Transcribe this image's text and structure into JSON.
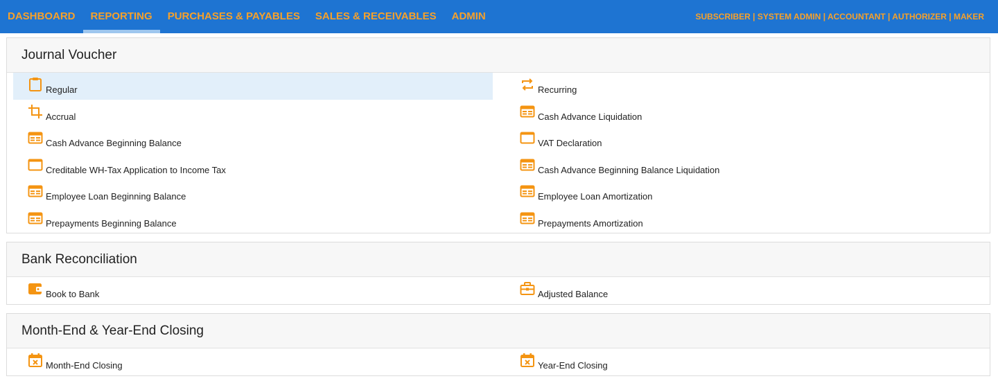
{
  "nav": {
    "items": [
      {
        "label": "DASHBOARD"
      },
      {
        "label": "REPORTING"
      },
      {
        "label": "PURCHASES & PAYABLES"
      },
      {
        "label": "SALES & RECEIVABLES"
      },
      {
        "label": "ADMIN"
      }
    ],
    "active": "REPORTING",
    "user_roles": "SUBSCRIBER | SYSTEM ADMIN | ACCOUNTANT | AUTHORIZER | MAKER"
  },
  "colors": {
    "topbar": "#1e74d2",
    "nav_text": "#f7a12a",
    "active_underline": "#9fc7ef",
    "icon": "#f49412",
    "highlight_row": "#e2effa"
  },
  "sections": [
    {
      "title": "Journal Voucher",
      "items": [
        {
          "label": "Regular",
          "icon": "clipboard-icon",
          "highlighted": true
        },
        {
          "label": "Recurring",
          "icon": "repeat-icon"
        },
        {
          "label": "Accrual",
          "icon": "crop-icon"
        },
        {
          "label": "Cash Advance Liquidation",
          "icon": "table-icon"
        },
        {
          "label": "Cash Advance Beginning Balance",
          "icon": "table-icon"
        },
        {
          "label": "VAT Declaration",
          "icon": "window-icon"
        },
        {
          "label": "Creditable WH-Tax Application to Income Tax",
          "icon": "window-icon"
        },
        {
          "label": "Cash Advance Beginning Balance Liquidation",
          "icon": "table-icon"
        },
        {
          "label": "Employee Loan Beginning Balance",
          "icon": "table-icon"
        },
        {
          "label": "Employee Loan Amortization",
          "icon": "table-icon"
        },
        {
          "label": "Prepayments Beginning Balance",
          "icon": "table-icon"
        },
        {
          "label": "Prepayments Amortization",
          "icon": "table-icon"
        }
      ]
    },
    {
      "title": "Bank Reconciliation",
      "items": [
        {
          "label": "Book to Bank",
          "icon": "wallet-icon"
        },
        {
          "label": "Adjusted Balance",
          "icon": "briefcase-icon"
        }
      ]
    },
    {
      "title": "Month-End & Year-End Closing",
      "items": [
        {
          "label": "Month-End Closing",
          "icon": "calendar-x-icon"
        },
        {
          "label": "Year-End Closing",
          "icon": "calendar-x-icon"
        }
      ]
    }
  ]
}
